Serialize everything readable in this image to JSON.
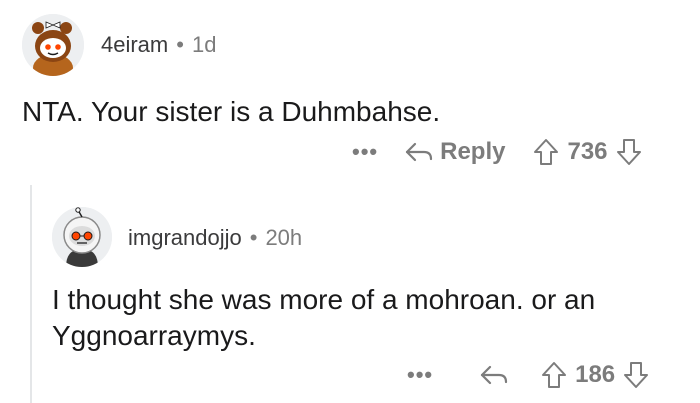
{
  "comments": [
    {
      "username": "4eiram",
      "separator": "•",
      "time": "1d",
      "body": "NTA. Your sister is a Duhmbahse.",
      "more_label": "•••",
      "reply_label": "Reply",
      "score": "736",
      "avatar_icon": "snoo-bear-hat-avatar"
    },
    {
      "username": "imgrandojjo",
      "separator": "•",
      "time": "20h",
      "body": "I thought she was more of a mohroan. or an Yggnoarraymys.",
      "more_label": "•••",
      "reply_label": "",
      "score": "186",
      "avatar_icon": "snoo-astronaut-avatar"
    }
  ],
  "colors": {
    "text": "#1a1a1b",
    "muted": "#7c7c7c",
    "thread_line": "#e4e6e8"
  }
}
